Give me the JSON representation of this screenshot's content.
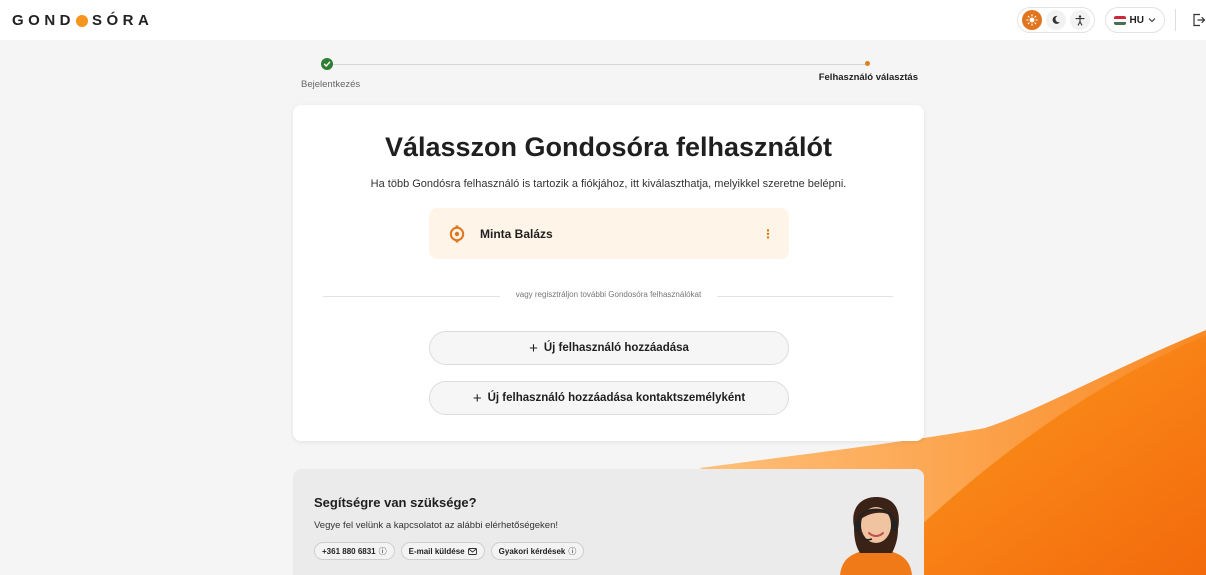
{
  "brand": {
    "logo_left": "GOND",
    "logo_right": "SÓRA",
    "accent": "#f7941d",
    "orange": "#e1751d",
    "green": "#2e7d32"
  },
  "topbar": {
    "theme_icons": [
      "sun-icon",
      "moon-icon",
      "accessibility-icon"
    ],
    "language": "HU",
    "logout_icon": "logout-icon"
  },
  "stepper": {
    "steps": [
      {
        "label": "Bejelentkezés",
        "state": "done"
      },
      {
        "label": "Felhasználó választás",
        "state": "current"
      }
    ]
  },
  "card": {
    "title": "Válasszon Gondosóra felhasználót",
    "subtitle": "Ha több Gondósra felhasználó is tartozik a fiókjához, itt kiválaszthatja, melyikkel szeretne belépni.",
    "users": [
      {
        "name": "Minta Balázs",
        "icon": "watch-icon",
        "menu_icon": "more-vertical-icon"
      }
    ],
    "divider_text": "vagy regisztráljon további Gondosóra felhasználókat",
    "add_user_label": "Új felhasználó hozzáadása",
    "add_contact_label": "Új felhasználó hozzáadása kontaktszemélyként"
  },
  "help": {
    "title": "Segítségre van szüksége?",
    "subtitle": "Vegye fel velünk a kapcsolatot az alábbi elérhetőségeken!",
    "phone": "+361 880 6831",
    "email": "E-mail küldése",
    "faq": "Gyakori kérdések"
  }
}
